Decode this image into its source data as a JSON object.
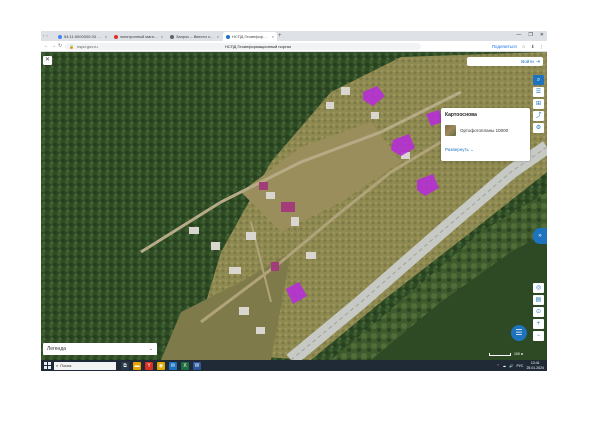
{
  "browser": {
    "tabs": [
      {
        "label": "54:11:0000000:33 Выписки",
        "favicon_color": "#4285f4"
      },
      {
        "label": "электронный магазин",
        "favicon_color": "#d93025"
      },
      {
        "label": "Запрос – Ввести запрос",
        "favicon_color": "#5f6368"
      },
      {
        "label": "НСПД Геоинформационный портал",
        "favicon_color": "#1e73be",
        "active": true
      }
    ],
    "close_glyph": "×",
    "newtab_glyph": "+",
    "tab_nav_glyphs": [
      "‹",
      "›"
    ],
    "window_controls": [
      "—",
      "❐",
      "✕"
    ],
    "nav": {
      "back": "←",
      "forward": "→",
      "reload": "↻"
    },
    "url": "nspd.gov.ru",
    "page_title": "НСПД Геоинформационный портал",
    "share_label": "Поделиться",
    "toolbar_icons": [
      "☆",
      "⬇",
      "⋮"
    ]
  },
  "map": {
    "close_glyph": "✕",
    "login_label": "Войти",
    "login_icon": "login-icon",
    "basemap_panel": {
      "title": "Картооснова",
      "selected_item": "Ортофотопланы 10000",
      "toggle_label": "Развернуть"
    },
    "legend_label": "Легенда",
    "legend_chevron": "⌄",
    "scale_label": "100 м",
    "tools": [
      {
        "name": "search-tool-icon",
        "glyph": "⌕",
        "primary": true
      },
      {
        "name": "layers-tool-icon",
        "glyph": "☰"
      },
      {
        "name": "measure-tool-icon",
        "glyph": "⊞"
      },
      {
        "name": "share-tool-icon",
        "glyph": "⤴"
      },
      {
        "name": "settings-tool-icon",
        "glyph": "⚙"
      }
    ],
    "zoom_tools": [
      {
        "name": "locate-icon",
        "glyph": "◎"
      },
      {
        "name": "print-icon",
        "glyph": "▤"
      },
      {
        "name": "pin-icon",
        "glyph": "⊙"
      },
      {
        "name": "zoom-in-icon",
        "glyph": "+"
      },
      {
        "name": "zoom-out-icon",
        "glyph": "−"
      }
    ],
    "chat_glyph": "☰",
    "side_glyph": "»"
  },
  "taskbar": {
    "search_placeholder": "Поиск",
    "search_glyph": "⌕",
    "apps": [
      {
        "name": "task-view-icon",
        "glyph": "⧉",
        "color": "#2b3a4a"
      },
      {
        "name": "file-explorer-icon",
        "glyph": "▬",
        "color": "#e6a400"
      },
      {
        "name": "yandex-browser-icon",
        "glyph": "Y",
        "color": "#d93025"
      },
      {
        "name": "chrome-icon",
        "glyph": "◉",
        "color": "#e0a800"
      },
      {
        "name": "mail-icon",
        "glyph": "✉",
        "color": "#1e73be"
      },
      {
        "name": "excel-icon",
        "glyph": "X",
        "color": "#1d6f42"
      },
      {
        "name": "word-icon",
        "glyph": "W",
        "color": "#2b579a"
      }
    ],
    "tray_icons": [
      "⌃",
      "☁",
      "🔊",
      "РУС"
    ],
    "time": "13:41",
    "date": "25.01.2024"
  }
}
